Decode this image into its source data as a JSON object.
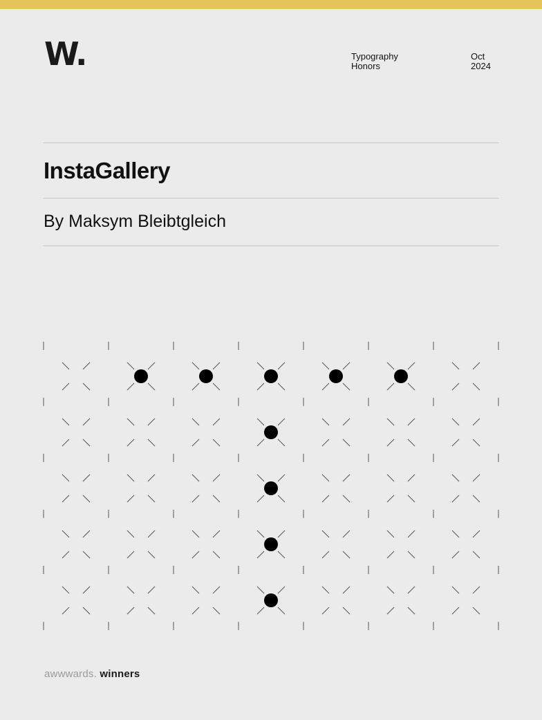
{
  "header": {
    "logo": "W.",
    "category_lines": [
      "Typography",
      "Honors"
    ],
    "date_lines": [
      "Oct",
      "2024"
    ]
  },
  "main": {
    "title": "InstaGallery",
    "byline": "By Maksym Bleibtgleich"
  },
  "pattern": {
    "columns": 7,
    "rows": 5,
    "filled_cells": [
      [
        0,
        1
      ],
      [
        0,
        2
      ],
      [
        0,
        3
      ],
      [
        0,
        4
      ],
      [
        0,
        5
      ],
      [
        1,
        3
      ],
      [
        2,
        3
      ],
      [
        3,
        3
      ],
      [
        4,
        3
      ]
    ]
  },
  "footer": {
    "brand": "awwwards.",
    "suffix": " winners"
  },
  "colors": {
    "accent": "#e6c45a",
    "background": "#ebebeb",
    "text": "#111111"
  }
}
